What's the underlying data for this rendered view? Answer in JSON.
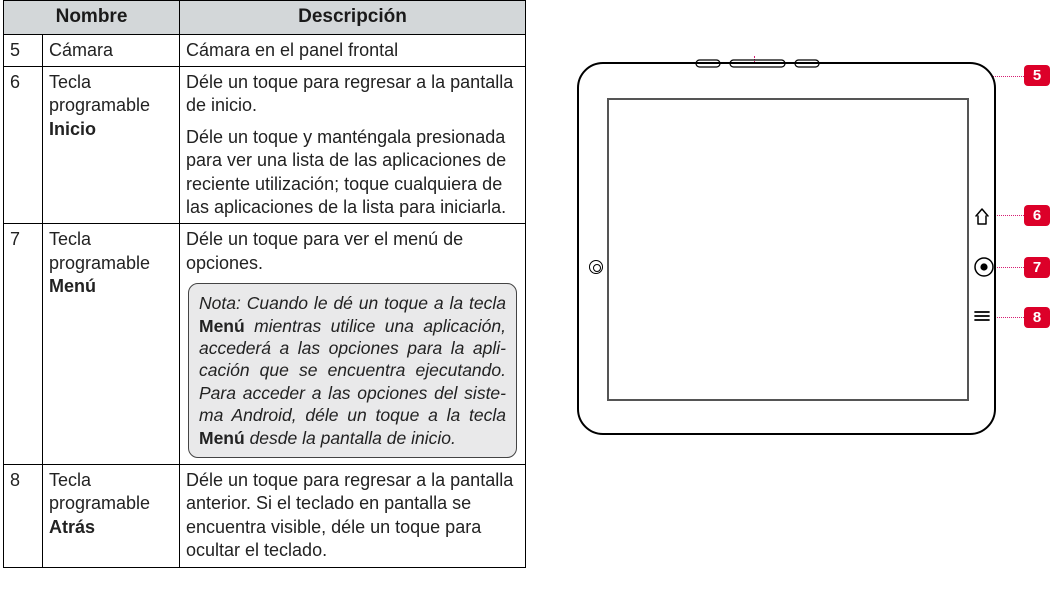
{
  "table": {
    "header": {
      "c1": "Nombre",
      "c2": "Descripción"
    },
    "rows": [
      {
        "num": "5",
        "name": "Cámara",
        "desc": "Cámara en el panel frontal"
      },
      {
        "num": "6",
        "name_pre": "Tecla programable ",
        "name_bold": "Inicio",
        "desc_p1": "Déle un toque para regresar a la pantalla de inicio.",
        "desc_p2": "Déle un toque y manténgala presionada para ver una lista de las aplicaciones de reciente utilización; toque cualquiera de las aplicaciones de la lista para iniciarla."
      },
      {
        "num": "7",
        "name_pre": "Tecla programable ",
        "name_bold": "Menú",
        "desc_p1": "Déle un toque para ver el menú de opciones.",
        "note_pre": "Nota: Cuando le dé un toque a la tecla ",
        "note_b1": "Menú",
        "note_mid": " mientras utilice una aplicación, accederá a las opciones para la apli­cación que se encuentra ejecutando. Para acceder a las opciones del siste­ma Android, déle un toque a la tecla ",
        "note_b2": "Menú",
        "note_end": " desde la pantalla de inicio."
      },
      {
        "num": "8",
        "name_pre": "Tecla programable ",
        "name_bold": "Atrás",
        "desc_p1": "Déle un toque para regresar a la pan­talla anterior. Si el teclado en pantalla se encuentra visible, déle un toque para ocultar el teclado."
      }
    ]
  },
  "callouts": {
    "c5": "5",
    "c6": "6",
    "c7": "7",
    "c8": "8"
  }
}
